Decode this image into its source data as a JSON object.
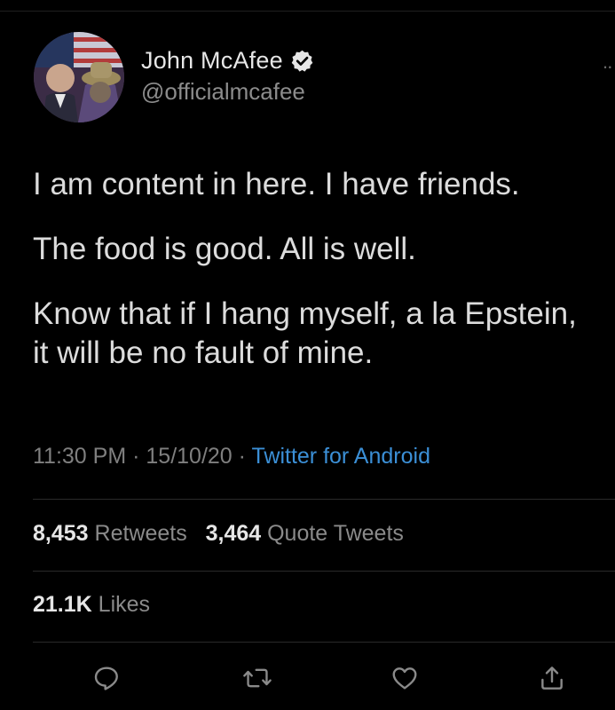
{
  "user": {
    "display_name": "John McAfee",
    "handle": "@officialmcafee",
    "verified_icon": "verified-badge-icon",
    "more_icon": "more-options-icon"
  },
  "tweet": {
    "paragraphs": [
      "I am content in here. I have friends.",
      "The food is good. All is well.",
      "Know that if I hang myself, a la Epstein, it will be no fault of mine."
    ],
    "time": "11:30 PM",
    "separator": "·",
    "date": "15/10/20",
    "source": "Twitter for Android"
  },
  "stats": {
    "retweets_count": "8,453",
    "retweets_label": "Retweets",
    "quotes_count": "3,464",
    "quotes_label": "Quote Tweets",
    "likes_count": "21.1K",
    "likes_label": "Likes"
  },
  "actions": [
    {
      "name": "reply",
      "icon": "reply-icon"
    },
    {
      "name": "retweet",
      "icon": "retweet-icon"
    },
    {
      "name": "like",
      "icon": "heart-icon"
    },
    {
      "name": "share",
      "icon": "share-icon"
    }
  ],
  "colors": {
    "background": "#000000",
    "link": "#3b8fd6",
    "verified": "#e6e6e6"
  }
}
